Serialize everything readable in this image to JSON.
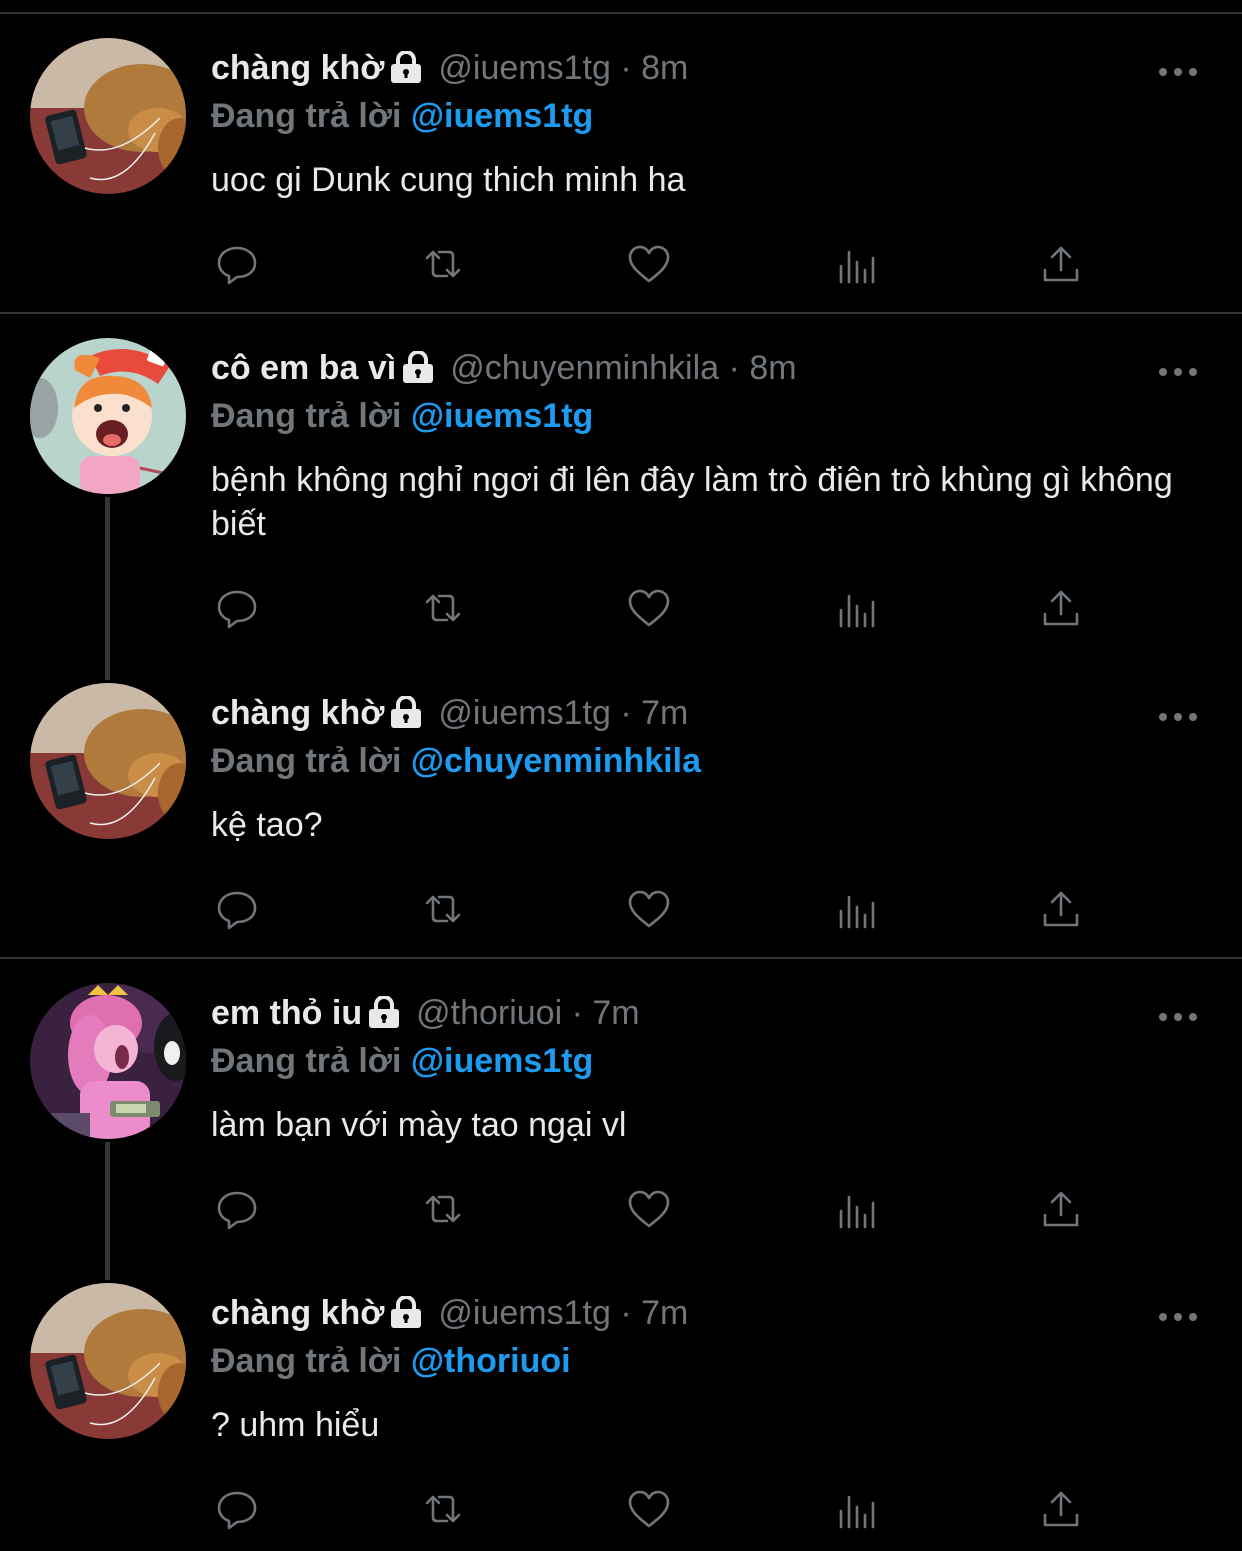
{
  "tweets": [
    {
      "name": "chàng khờ",
      "handle": "@iuems1tg",
      "dot": "·",
      "time": "8m",
      "reply_label": "Đang trả lời",
      "reply_to": "@iuems1tg",
      "text": "uoc gi Dunk cung thich minh ha",
      "avatar": "dog-avatar",
      "protected": true
    },
    {
      "name": "cô em ba vì",
      "handle": "@chuyenminhkila",
      "dot": "·",
      "time": "8m",
      "reply_label": "Đang trả lời",
      "reply_to": "@iuems1tg",
      "text": "bệnh không nghỉ ngơi đi lên đây làm trò điên trò khùng gì không biết",
      "avatar": "cartoon-girl-avatar",
      "protected": true
    },
    {
      "name": "chàng khờ",
      "handle": "@iuems1tg",
      "dot": "·",
      "time": "7m",
      "reply_label": "Đang trả lời",
      "reply_to": "@chuyenminhkila",
      "text": "kệ tao?",
      "avatar": "dog-avatar",
      "protected": true
    },
    {
      "name": "em thỏ iu",
      "handle": "@thoriuoi",
      "dot": "·",
      "time": "7m",
      "reply_label": "Đang trả lời",
      "reply_to": "@iuems1tg",
      "text": "làm bạn với mày tao ngại vl",
      "avatar": "princess-avatar",
      "protected": true
    },
    {
      "name": "chàng khờ",
      "handle": "@iuems1tg",
      "dot": "·",
      "time": "7m",
      "reply_label": "Đang trả lời",
      "reply_to": "@thoriuoi",
      "text": "? uhm hiểu",
      "avatar": "dog-avatar",
      "protected": true
    }
  ],
  "icons": [
    "lock-icon",
    "more-icon",
    "reply-icon",
    "retweet-icon",
    "like-icon",
    "views-icon",
    "share-icon"
  ],
  "colors": {
    "background": "#000000",
    "text": "#e7e9ea",
    "muted": "#71767b",
    "mention": "#1d9bf0",
    "divider": "#2f3336"
  }
}
